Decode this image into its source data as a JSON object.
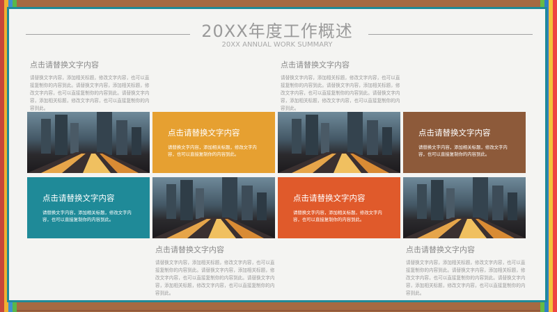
{
  "header": {
    "title": "20XX年度工作概述",
    "subtitle": "20XX ANNUAL WORK SUMMARY"
  },
  "blocks": [
    {
      "title": "点击请替换文字内容",
      "body": "请替换文字内容，添加相关标题，修改文字内容，也可以直接复制你的内容到此。请替换文字内容，添加相关标题，修改文字内容，也可以直接复制你的内容到此。请替换文字内容，添加相关标题，修改文字内容，也可以直接复制你的内容到此。"
    },
    {
      "title": "点击请替换文字内容",
      "body": "请替换文字内容，添加相关标题，修改文字内容，也可以直接复制你的内容到此。请替换文字内容，添加相关标题，修改文字内容，也可以直接复制你的内容到此。请替换文字内容，添加相关标题，修改文字内容，也可以直接复制你的内容到此。"
    },
    {
      "title": "点击请替换文字内容",
      "body": "请替换文字内容，添加相关标题，修改文字内容，也可以直接复制你的内容到此。请替换文字内容，添加相关标题，修改文字内容，也可以直接复制你的内容到此。请替换文字内容，添加相关标题，修改文字内容，也可以直接复制你的内容到此。"
    },
    {
      "title": "点击请替换文字内容",
      "body": "请替换文字内容，添加相关标题，修改文字内容，也可以直接复制你的内容到此。请替换文字内容，添加相关标题，修改文字内容，也可以直接复制你的内容到此。请替换文字内容，添加相关标题，修改文字内容，也可以直接复制你的内容到此。"
    }
  ],
  "tiles": [
    {
      "title": "点击请替换文字内容",
      "body": "请替换文字内容，添加相关标题，修改文字内容，也可以直接复制你的内容到此。"
    },
    {
      "title": "点击请替换文字内容",
      "body": "请替换文字内容，添加相关标题，修改文字内容，也可以直接复制你的内容到此。"
    },
    {
      "title": "点击请替换文字内容",
      "body": "请替换文字内容，添加相关标题，修改文字内容，也可以直接复制你的内容到此。"
    },
    {
      "title": "点击请替换文字内容",
      "body": "请替换文字内容，添加相关标题，修改文字内容，也可以直接复制你的内容到此。"
    }
  ],
  "colors": {
    "accent_teal": "#1f8a98",
    "yellow": "#e6a031",
    "orange": "#e05a2b",
    "brown": "#8d5a3a"
  }
}
